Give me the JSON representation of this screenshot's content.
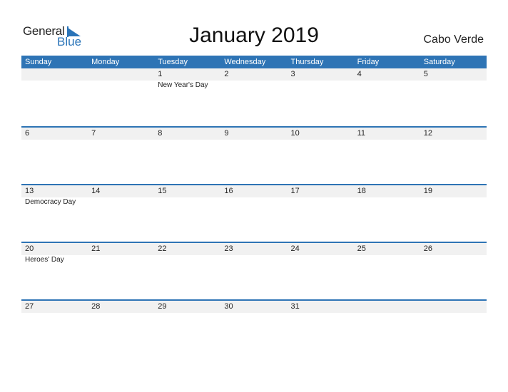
{
  "logo": {
    "general": "General",
    "blue": "Blue",
    "color": "#2a74b8"
  },
  "title": "January 2019",
  "country": "Cabo Verde",
  "accent": "#2e74b5",
  "days": [
    "Sunday",
    "Monday",
    "Tuesday",
    "Wednesday",
    "Thursday",
    "Friday",
    "Saturday"
  ],
  "weeks": [
    {
      "dates": [
        "",
        "",
        "1",
        "2",
        "3",
        "4",
        "5"
      ],
      "events": [
        "",
        "",
        "New Year's Day",
        "",
        "",
        "",
        ""
      ]
    },
    {
      "dates": [
        "6",
        "7",
        "8",
        "9",
        "10",
        "11",
        "12"
      ],
      "events": [
        "",
        "",
        "",
        "",
        "",
        "",
        ""
      ]
    },
    {
      "dates": [
        "13",
        "14",
        "15",
        "16",
        "17",
        "18",
        "19"
      ],
      "events": [
        "Democracy Day",
        "",
        "",
        "",
        "",
        "",
        ""
      ]
    },
    {
      "dates": [
        "20",
        "21",
        "22",
        "23",
        "24",
        "25",
        "26"
      ],
      "events": [
        "Heroes' Day",
        "",
        "",
        "",
        "",
        "",
        ""
      ]
    },
    {
      "dates": [
        "27",
        "28",
        "29",
        "30",
        "31",
        "",
        ""
      ],
      "events": [
        "",
        "",
        "",
        "",
        "",
        "",
        ""
      ]
    }
  ]
}
